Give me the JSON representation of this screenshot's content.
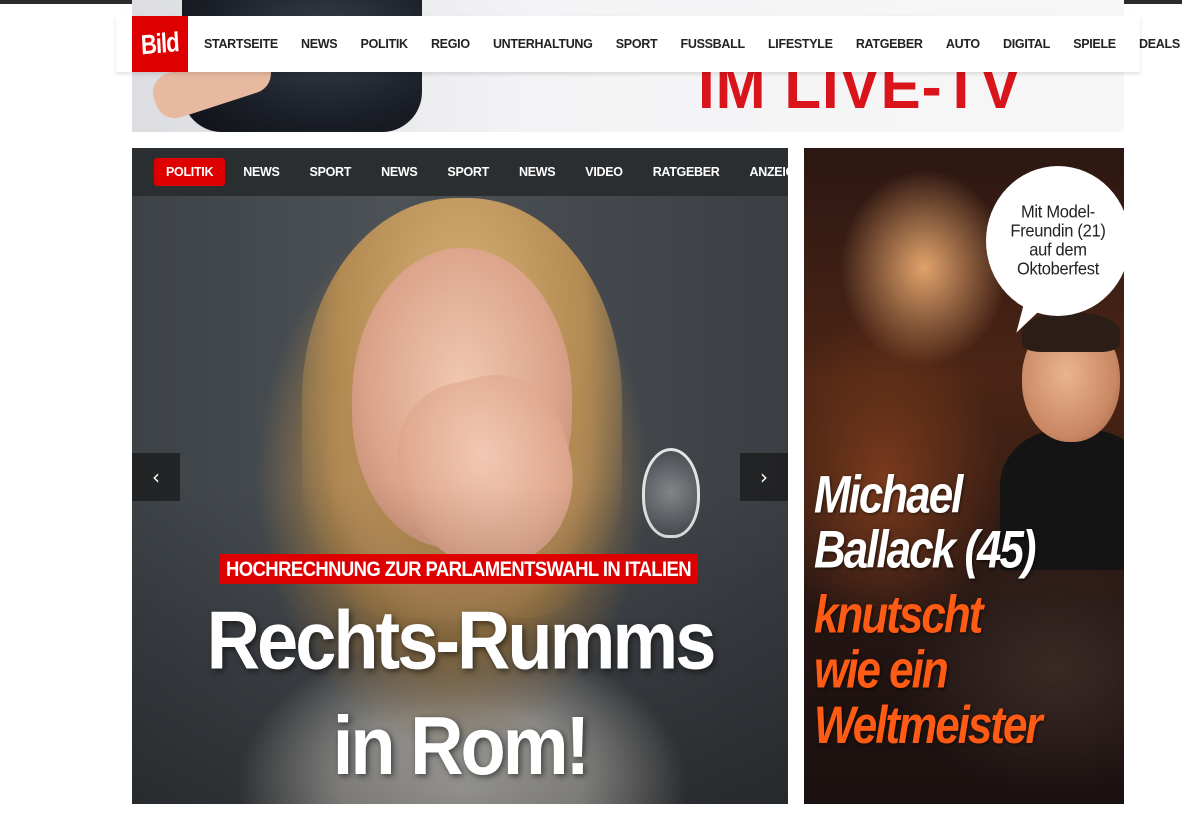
{
  "header": {
    "logo_text": "Bild",
    "nav": [
      "STARTSEITE",
      "NEWS",
      "POLITIK",
      "REGIO",
      "UNTERHALTUNG",
      "SPORT",
      "FUSSBALL",
      "LIFESTYLE",
      "RATGEBER",
      "AUTO",
      "DIGITAL",
      "SPIELE",
      "DEALS"
    ]
  },
  "banner": {
    "text": "IM LIVE-TV"
  },
  "carousel": {
    "tabs": [
      "POLITIK",
      "NEWS",
      "SPORT",
      "NEWS",
      "SPORT",
      "NEWS",
      "VIDEO",
      "RATGEBER",
      "ANZEIGE"
    ],
    "active_tab": 0,
    "prev_icon": "chevron-left-icon",
    "next_icon": "chevron-right-icon",
    "kicker": "HOCHRECHNUNG ZUR PARLAMENTSWAHL IN ITALIEN",
    "title_lines": [
      "Rechts-Rumms",
      "in Rom!"
    ]
  },
  "teaser": {
    "bubble_lines": [
      "Mit Model-",
      "Freundin (21)",
      "auf dem",
      "Oktoberfest"
    ],
    "name_lines": [
      "Michael",
      "Ballack (45)"
    ],
    "text_lines": [
      "knutscht",
      "wie ein",
      "Weltmeister"
    ]
  },
  "colors": {
    "brand_red": "#de0000",
    "teaser_orange": "#ff5b14",
    "subnav_bg": "#2b2e31"
  }
}
